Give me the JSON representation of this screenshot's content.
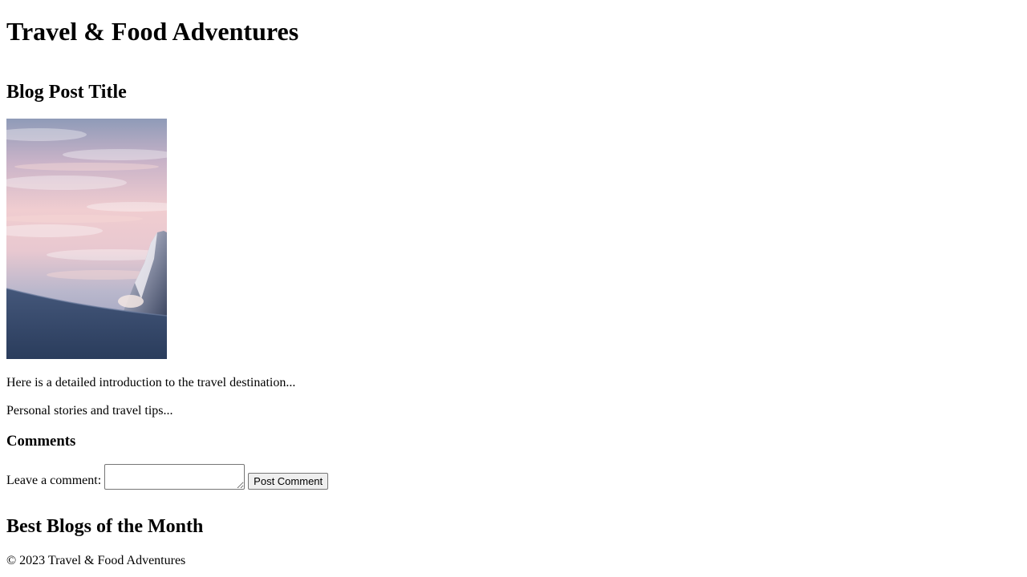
{
  "header": {
    "site_title": "Travel & Food Adventures"
  },
  "post": {
    "title": "Blog Post Title",
    "image_icon": "mountain-sunset-photo",
    "intro": "Here is a detailed introduction to the travel destination...",
    "stories": "Personal stories and travel tips..."
  },
  "comments": {
    "heading": "Comments",
    "label": "Leave a comment:",
    "input_value": "",
    "submit_label": "Post Comment"
  },
  "best_blogs": {
    "heading": "Best Blogs of the Month"
  },
  "footer": {
    "copyright": "© 2023 Travel & Food Adventures"
  }
}
